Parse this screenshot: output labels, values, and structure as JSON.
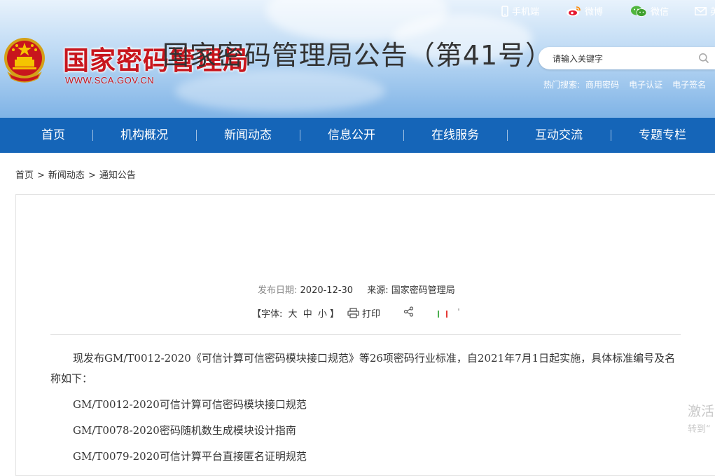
{
  "header": {
    "site_name": "国家密码管理局",
    "site_url": "WWW.SCA.GOV.CN",
    "top_links": [
      "手机端",
      "微博",
      "微信",
      "英文"
    ],
    "search": {
      "placeholder": "请输入关键字"
    },
    "hot_search": {
      "label": "热门搜索:",
      "terms": [
        "商用密码",
        "电子认证",
        "电子签名"
      ]
    }
  },
  "nav": {
    "items": [
      "首页",
      "机构概况",
      "新闻动态",
      "信息公开",
      "在线服务",
      "互动交流",
      "专题专栏"
    ]
  },
  "breadcrumb": [
    "首页",
    "新闻动态",
    "通知公告"
  ],
  "article": {
    "title": "国家密码管理局公告（第41号）",
    "publish_label": "发布日期:",
    "publish_date": "2020-12-30",
    "source_label": "来源:",
    "source": "国家密码管理局",
    "font_label_open": "【字体:",
    "font_sizes": [
      "大",
      "中",
      "小"
    ],
    "font_label_close": "】",
    "print_label": "打印",
    "intro": "现发布GM/T0012-2020《可信计算可信密码模块接口规范》等26项密码行业标准，自2021年7月1日起实施，具体标准编号及名称如下：",
    "items": [
      "GM/T0012-2020可信计算可信密码模块接口规范",
      "GM/T0078-2020密码随机数生成模块设计指南",
      "GM/T0079-2020可信计算平台直接匿名证明规范"
    ]
  },
  "watermark": {
    "line1": "激活",
    "line2": "转到“"
  },
  "colors": {
    "brand_red": "#c8161d",
    "nav_blue": "#1565b8"
  }
}
